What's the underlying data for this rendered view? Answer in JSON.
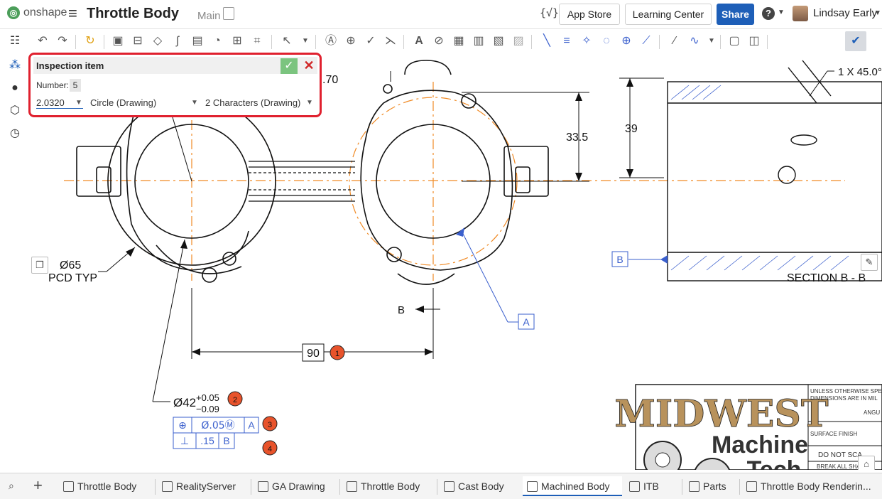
{
  "header": {
    "logo_text": "onshape",
    "doc_title": "Throttle Body",
    "branch": "Main",
    "var_icon": "{√}",
    "app_store": "App Store",
    "learning_center": "Learning Center",
    "share": "Share",
    "help": "?",
    "user": "Lindsay Early"
  },
  "toolbar": {
    "icons": [
      "undo-icon",
      "redo-icon",
      "regenerate-icon",
      "view-icon",
      "section-view-icon",
      "projected-view-icon",
      "break-view-icon",
      "crop-view-icon",
      "detail-view-icon",
      "broken-out-icon",
      "alignment-icon",
      "dimension-icon",
      "note-icon",
      "datum-icon",
      "surface-finish-icon",
      "weld-icon",
      "text-icon",
      "callout-icon",
      "table-icon",
      "bom-icon",
      "hole-table-icon",
      "revision-icon",
      "line-icon",
      "hatch-icon",
      "centermark-icon",
      "circle-icon",
      "point-icon",
      "centerline-icon",
      "spline-icon",
      "curve-icon",
      "export-dxf-icon",
      "export-image-icon",
      "inspection-icon"
    ]
  },
  "inspection_dialog": {
    "title": "Inspection item",
    "number_label": "Number:",
    "number_value": "5",
    "value": "2.0320",
    "type": "Circle (Drawing)",
    "characters": "2 Characters (Drawing)",
    "ok": "✓",
    "cancel": "✕"
  },
  "drawing": {
    "dim_70": ".70",
    "dim_335": "33.5",
    "dim_39": "39",
    "dim_chamfer": "1 X 45.0°",
    "pcd_dia": "Ø65",
    "pcd_typ": "PCD TYP",
    "bore_dia": "Ø42",
    "tol_plus": "+0.05",
    "tol_minus": "−0.09",
    "dim_90": "90",
    "section_label": "SECTION B - B",
    "section_arrow": "B",
    "datum_a": "A",
    "datum_b": "B",
    "fcf1_sym": "⊕",
    "fcf1_value": "Ø.05Ⓜ",
    "fcf1_ref": "A",
    "fcf2_sym": "⊥",
    "fcf2_value": ".15",
    "fcf2_ref": "B",
    "balloons": [
      "1",
      "2",
      "3",
      "4"
    ]
  },
  "titleblock": {
    "logo1": "MIDWEST",
    "logo2": "Machine",
    "logo3": "Tech",
    "note1": "UNLESS OTHERWISE SPE",
    "note2": "DIMENSIONS ARE IN MIL",
    "angu": "ANGU",
    "surface": "SURFACE FINISH",
    "donot": "DO NOT SCA",
    "break": "BREAK ALL SHA"
  },
  "tabs": [
    {
      "label": "Throttle Body"
    },
    {
      "label": "RealityServer"
    },
    {
      "label": "GA Drawing"
    },
    {
      "label": "Throttle Body"
    },
    {
      "label": "Cast Body"
    },
    {
      "label": "Machined Body"
    },
    {
      "label": "ITB"
    },
    {
      "label": "Parts"
    },
    {
      "label": "Throttle Body Renderin..."
    }
  ],
  "colors": {
    "accent": "#1e5fb8",
    "highlight": "#e0202e",
    "balloon": "#e8532b",
    "centerline": "#f08a24",
    "leader": "#3a5fcd"
  }
}
